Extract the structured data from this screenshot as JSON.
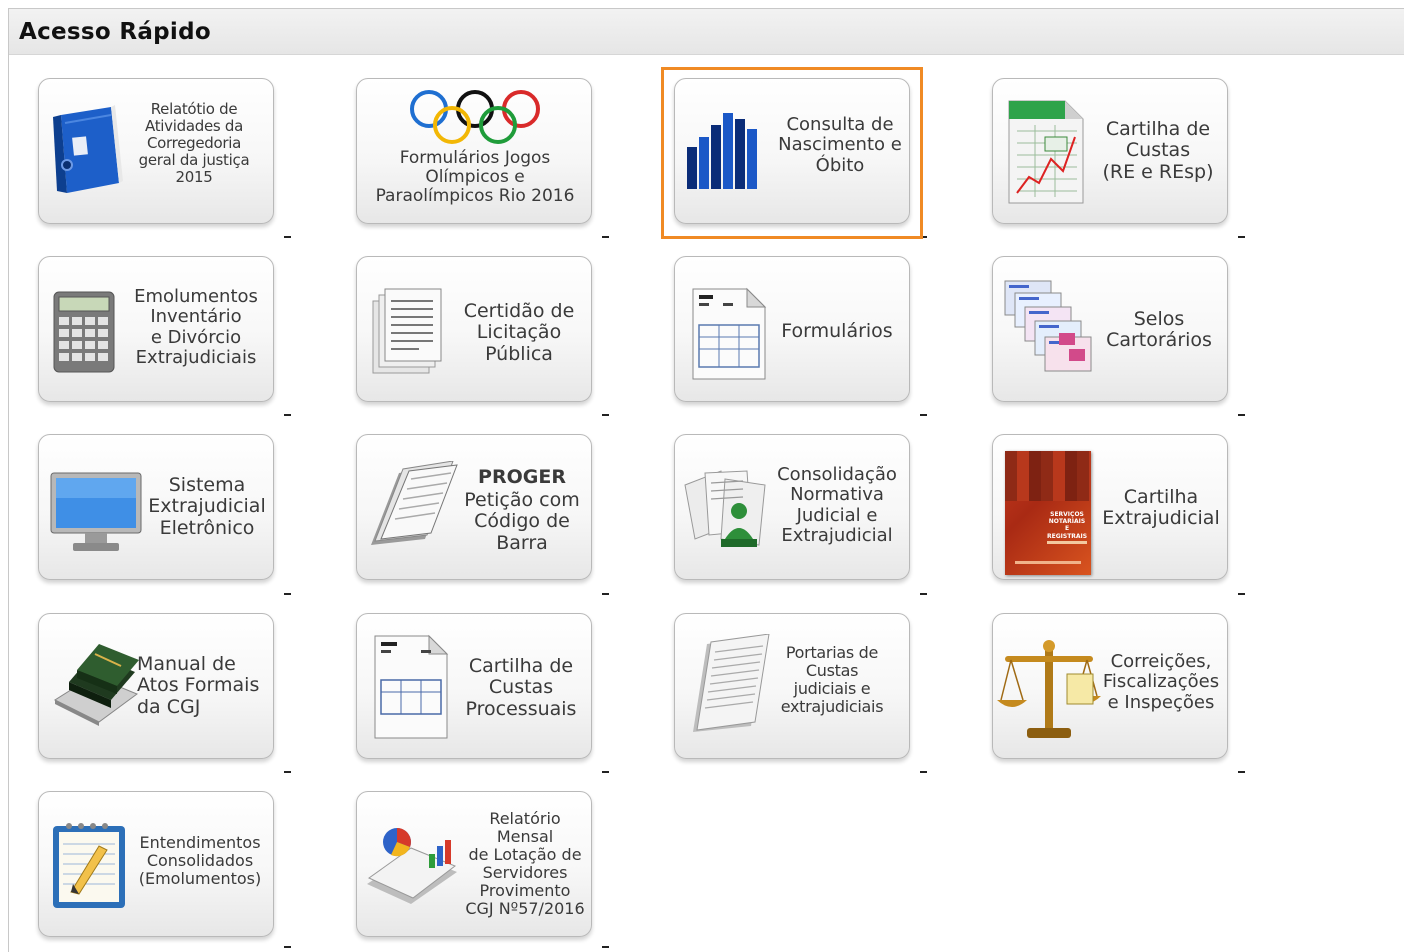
{
  "header": {
    "title": "Acesso Rápido"
  },
  "colors": {
    "highlight": "#f08a24"
  },
  "tiles": [
    {
      "id": "relatorio-atividades",
      "icon": "blue-binder-icon",
      "label": "Relatótio de\nAtividades da\nCorregedoria\ngeral da justiça\n2015",
      "suffix": "-"
    },
    {
      "id": "formularios-jogos",
      "icon": "olympic-rings-icon",
      "label": "Formulários Jogos\nOlímpicos e\nParaolímpicos Rio 2016",
      "suffix": "-"
    },
    {
      "id": "consulta-nascimento",
      "icon": "bar-chart-icon",
      "label": "Consulta de\nNascimento e\nÓbito",
      "suffix": "-"
    },
    {
      "id": "cartilha-custas-re",
      "icon": "spreadsheet-chart-icon",
      "label": "Cartilha de\nCustas\n(RE e REsp)",
      "suffix": "-"
    },
    {
      "id": "emolumentos",
      "icon": "calculator-icon",
      "label": "Emolumentos\nInventário\ne Divórcio\nExtrajudiciais",
      "suffix": "-"
    },
    {
      "id": "certidao-licitacao",
      "icon": "stacked-documents-icon",
      "label": "Certidão de\nLicitação\nPública",
      "suffix": "-"
    },
    {
      "id": "formularios",
      "icon": "form-document-icon",
      "label": "Formulários",
      "suffix": "-"
    },
    {
      "id": "selos",
      "icon": "stamps-icon",
      "label": "Selos\nCartorários",
      "suffix": "-"
    },
    {
      "id": "sistema-extrajudicial",
      "icon": "monitor-icon",
      "label": "Sistema\nExtrajudicial\nEletrônico",
      "suffix": "-"
    },
    {
      "id": "proger",
      "icon": "paper-stack-icon",
      "label_bold": "PROGER",
      "label": "Petição com\nCódigo de\nBarra",
      "suffix": "-"
    },
    {
      "id": "consolidacao",
      "icon": "documents-user-icon",
      "label": "Consolidação\nNormativa\nJudicial e\nExtrajudicial",
      "suffix": "-"
    },
    {
      "id": "cartilha-extrajudicial",
      "icon": "booklet-cover-icon",
      "label": "Cartilha\nExtrajudicial",
      "suffix": "-",
      "booklet_text": "SERVIÇOS NOTARIAIS E REGISTRAIS"
    },
    {
      "id": "manual-atos",
      "icon": "books-icon",
      "label": "Manual de\nAtos Formais\nda CGJ",
      "suffix": "-"
    },
    {
      "id": "cartilha-custas-processuais",
      "icon": "form-document-icon",
      "label": "Cartilha de\nCustas\nProcessuais",
      "suffix": "-"
    },
    {
      "id": "portarias-custas",
      "icon": "paper-document-icon",
      "label": "Portarias de\nCustas\njudiciais e\nextrajudiciais",
      "suffix": "-"
    },
    {
      "id": "correicoes",
      "icon": "scales-icon",
      "label": "Correições,\nFiscalizações\ne Inspeções",
      "suffix": "-"
    },
    {
      "id": "entendimentos",
      "icon": "notepad-pencil-icon",
      "label": "Entendimentos\nConsolidados\n(Emolumentos)",
      "suffix": "-"
    },
    {
      "id": "relatorio-lotacao",
      "icon": "report-chart-icon",
      "label": "Relatório\nMensal\nde Lotação de\nServidores\nProvimento\nCGJ Nº57/2016",
      "suffix": "-"
    }
  ]
}
